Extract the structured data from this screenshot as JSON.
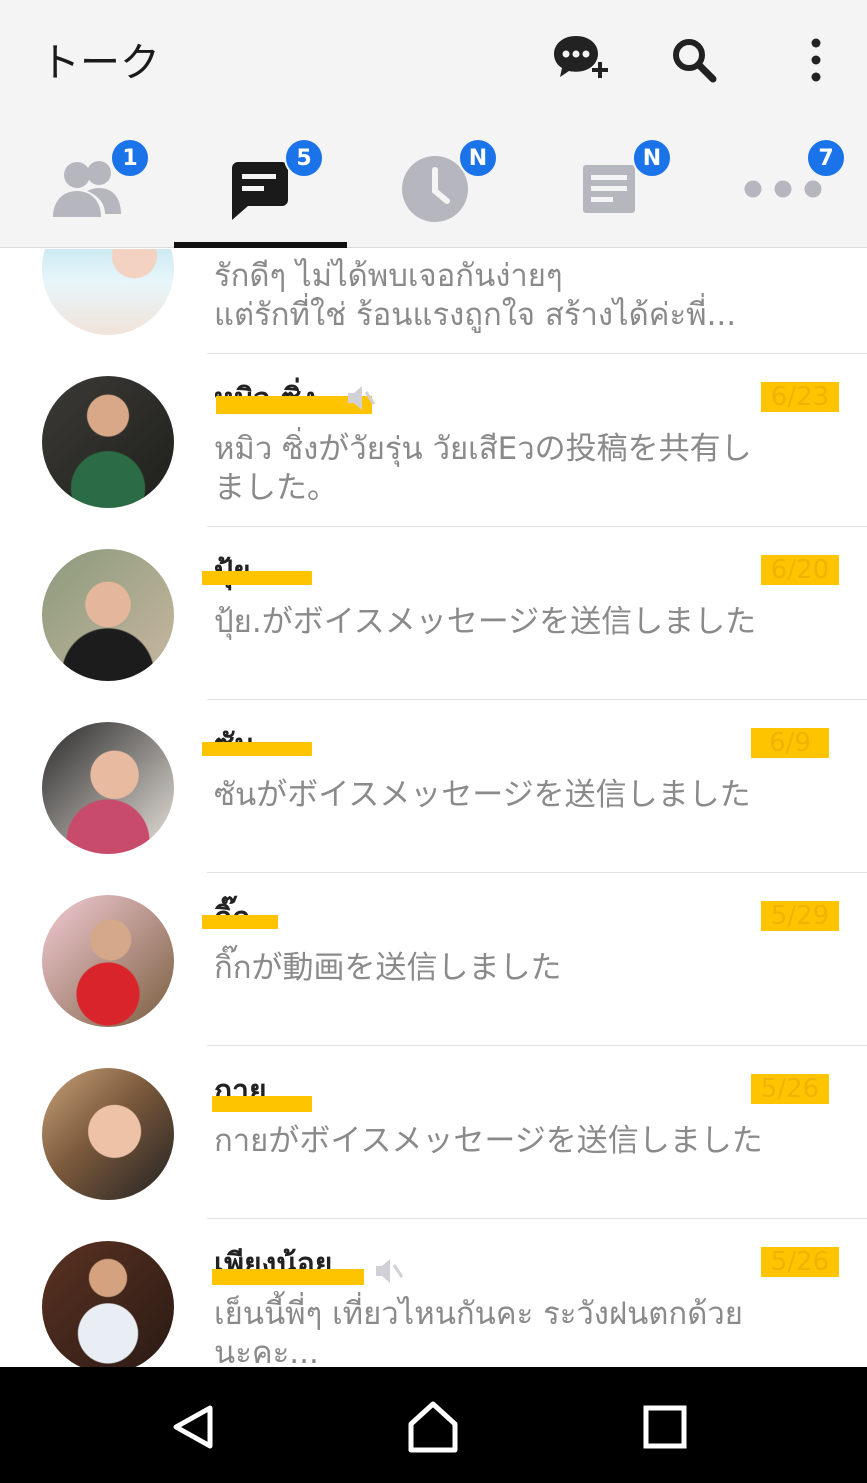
{
  "header": {
    "title": "トーク",
    "icons": [
      "new-chat-icon",
      "search-icon",
      "more-vertical-icon"
    ]
  },
  "tabs": [
    {
      "icon": "friends-icon",
      "badge": "1",
      "active": false
    },
    {
      "icon": "chats-icon",
      "badge": "5",
      "active": true
    },
    {
      "icon": "timeline-icon",
      "badge": "N",
      "active": false
    },
    {
      "icon": "news-icon",
      "badge": "N",
      "active": false
    },
    {
      "icon": "more-horizontal-icon",
      "badge": "7",
      "active": false
    }
  ],
  "chats": [
    {
      "name": "",
      "date": "",
      "muted": false,
      "preview": "รักดีๆ ไม่ได้พบเจอกันง่ายๆ\nแต่รักที่ใช่ ร้อนแรงถูกใจ สร้างได้ค่ะพี่..."
    },
    {
      "name": "หมิว ซิ่ง",
      "date": "6/23",
      "muted": true,
      "preview": "หมิว ซิ่งがวัยรุ่น วัยเสีEวの投稿を共有しました。"
    },
    {
      "name": "ปุ้ย.",
      "date": "6/20",
      "muted": false,
      "preview": "ปุ้ย.がボイスメッセージを送信しました"
    },
    {
      "name": "ซัน",
      "date": "6/9",
      "muted": false,
      "preview": "ซันがボイスメッセージを送信しました"
    },
    {
      "name": "กิ๊ก",
      "date": "5/29",
      "muted": false,
      "preview": "กิ๊กが動画を送信しました"
    },
    {
      "name": "กาย",
      "date": "5/26",
      "muted": false,
      "preview": "กายがボイスメッセージを送信しました"
    },
    {
      "name": "เพียงน้อย",
      "date": "5/26",
      "muted": true,
      "preview": "เย็นนี้พี่ๆ เที่ยวไหนกันคะ ระวังฝนตกด้วย\nนะคะ..."
    }
  ],
  "navbar": {
    "icons": [
      "back-icon",
      "home-icon",
      "recents-icon"
    ]
  },
  "colors": {
    "accent": "#1a73e8",
    "redaction": "#ffc400",
    "header_bg": "#f4f4f4",
    "preview_text": "#8a8a8a"
  }
}
